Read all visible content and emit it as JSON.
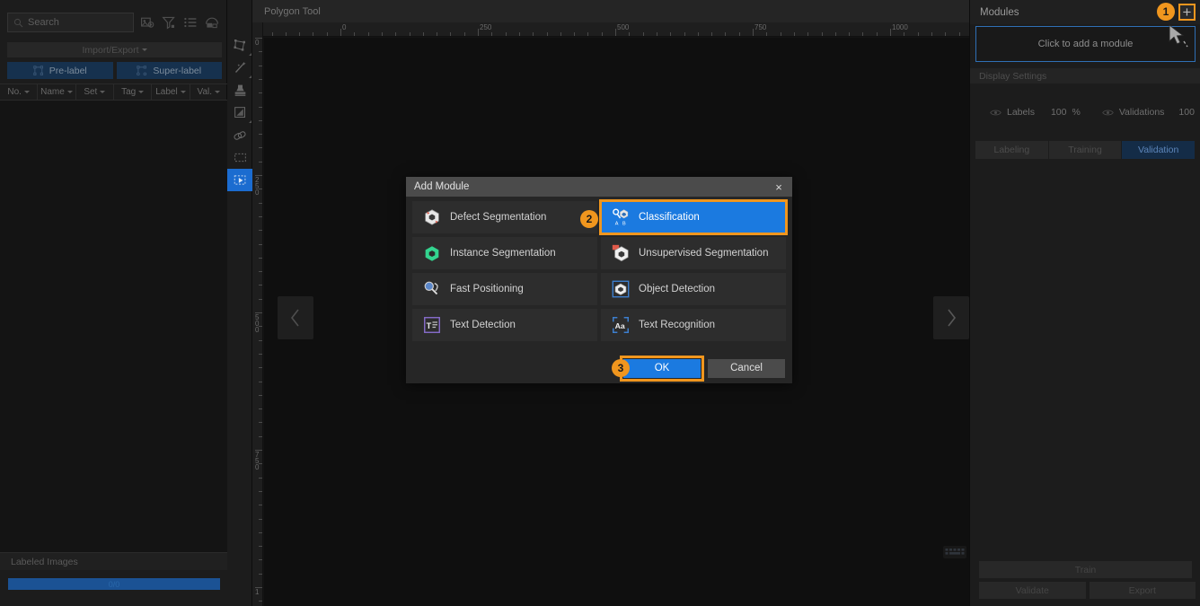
{
  "left_panel": {
    "search": {
      "placeholder": "Search",
      "icon": "search-icon"
    },
    "top_icons": [
      "image-filter-icon",
      "funnel-filter-icon",
      "list-view-icon",
      "thumbnail-view-icon"
    ],
    "import_export": {
      "label": "Import/Export"
    },
    "buttons": [
      {
        "label": "Pre-label",
        "icon": "pre-label-icon"
      },
      {
        "label": "Super-label",
        "icon": "super-label-icon"
      }
    ],
    "columns": [
      {
        "label": "No."
      },
      {
        "label": "Name"
      },
      {
        "label": "Set"
      },
      {
        "label": "Tag"
      },
      {
        "label": "Label"
      },
      {
        "label": "Val."
      }
    ],
    "labeled_images": {
      "label": "Labeled Images",
      "progress_text": "0/0",
      "progress_percent": 100
    }
  },
  "toolbar": {
    "tools": [
      {
        "name": "polygon-tool",
        "icon": "polygon-icon"
      },
      {
        "name": "magic-wand-tool",
        "icon": "magic-wand-icon"
      },
      {
        "name": "stamp-tool",
        "icon": "stamp-icon"
      },
      {
        "name": "shape-tool",
        "icon": "shape-icon"
      },
      {
        "name": "eraser-tool",
        "icon": "eraser-icon"
      },
      {
        "name": "marquee-select-tool",
        "icon": "dashed-rect-icon"
      },
      {
        "name": "move-tool",
        "icon": "move-select-icon",
        "active": true
      }
    ]
  },
  "canvas": {
    "title": "Polygon Tool",
    "ruler_h_labels": [
      "0",
      "250",
      "500",
      "750",
      "1000"
    ],
    "ruler_v_labels": [
      "0",
      "250",
      "500",
      "750",
      "1"
    ],
    "nav_prev": "‹",
    "nav_next": "›",
    "keyboard_icon": "keyboard-shortcuts-icon"
  },
  "right_panel": {
    "header_title": "Modules",
    "add_button_label": "+",
    "dropzone_text": "Click to add a module",
    "display_settings_label": "Display Settings",
    "visibility": [
      {
        "label": "Labels",
        "value": "100",
        "unit": "%"
      },
      {
        "label": "Validations",
        "value": "100",
        "unit": "%"
      }
    ],
    "tabs": [
      {
        "label": "Labeling",
        "active": false
      },
      {
        "label": "Training",
        "active": false
      },
      {
        "label": "Validation",
        "active": true
      }
    ],
    "actions": {
      "train": "Train",
      "validate": "Validate",
      "export": "Export"
    }
  },
  "modal": {
    "title": "Add Module",
    "close_label": "×",
    "modules": [
      {
        "label": "Defect Segmentation",
        "icon": "defect-segmentation-icon",
        "selected": false
      },
      {
        "label": "Classification",
        "icon": "classification-icon",
        "selected": true
      },
      {
        "label": "Instance Segmentation",
        "icon": "instance-segmentation-icon",
        "selected": false
      },
      {
        "label": "Unsupervised Segmentation",
        "icon": "unsupervised-segmentation-icon",
        "selected": false
      },
      {
        "label": "Fast Positioning",
        "icon": "fast-positioning-icon",
        "selected": false
      },
      {
        "label": "Object Detection",
        "icon": "object-detection-icon",
        "selected": false
      },
      {
        "label": "Text Detection",
        "icon": "text-detection-icon",
        "selected": false
      },
      {
        "label": "Text Recognition",
        "icon": "text-recognition-icon",
        "selected": false
      }
    ],
    "ok_label": "OK",
    "cancel_label": "Cancel"
  },
  "steps": [
    {
      "number": "1"
    },
    {
      "number": "2"
    },
    {
      "number": "3"
    }
  ],
  "colors": {
    "accent_blue": "#1b7ae0",
    "highlight_orange": "#f0961e",
    "panel_bg": "#1c1c1c",
    "canvas_bg": "#0f0f0f"
  }
}
